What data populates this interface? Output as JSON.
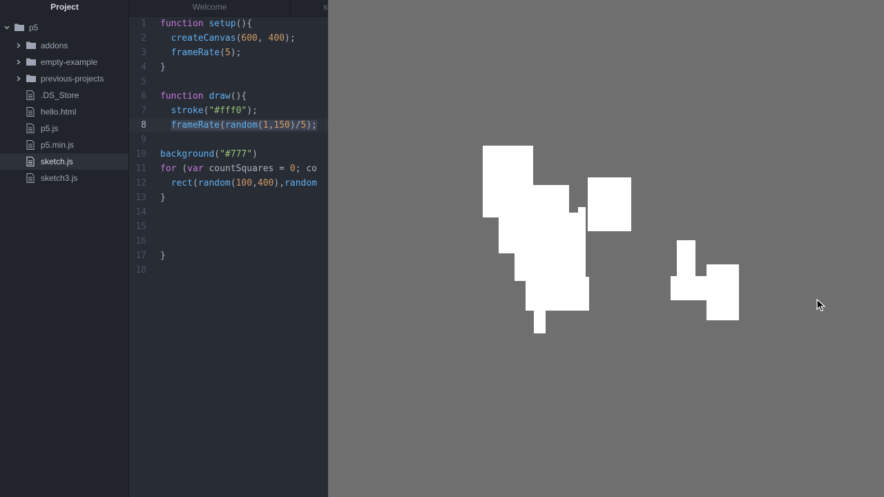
{
  "sidebar": {
    "title": "Project",
    "root": "p5",
    "items": [
      {
        "label": "addons",
        "type": "folder"
      },
      {
        "label": "empty-example",
        "type": "folder"
      },
      {
        "label": "previous-projects",
        "type": "folder"
      },
      {
        "label": ".DS_Store",
        "type": "file"
      },
      {
        "label": "hello.html",
        "type": "file"
      },
      {
        "label": "p5.js",
        "type": "file"
      },
      {
        "label": "p5.min.js",
        "type": "file"
      },
      {
        "label": "sketch.js",
        "type": "file",
        "selected": true
      },
      {
        "label": "sketch3.js",
        "type": "file"
      }
    ]
  },
  "tabs": {
    "welcome": "Welcome",
    "sketch": "sketch.js"
  },
  "editor": {
    "cursor_line": 8,
    "lines": [
      [
        [
          "kw",
          "function "
        ],
        [
          "fn",
          "setup"
        ],
        [
          "pl",
          "(){"
        ]
      ],
      [
        [
          "pl",
          "  "
        ],
        [
          "fn",
          "createCanvas"
        ],
        [
          "pl",
          "("
        ],
        [
          "num",
          "600"
        ],
        [
          "pl",
          ", "
        ],
        [
          "num",
          "400"
        ],
        [
          "pl",
          ");"
        ]
      ],
      [
        [
          "pl",
          "  "
        ],
        [
          "fn",
          "frameRate"
        ],
        [
          "pl",
          "("
        ],
        [
          "num",
          "5"
        ],
        [
          "pl",
          ");"
        ]
      ],
      [
        [
          "pl",
          "}"
        ]
      ],
      [],
      [
        [
          "kw",
          "function "
        ],
        [
          "fn",
          "draw"
        ],
        [
          "pl",
          "(){"
        ]
      ],
      [
        [
          "pl",
          "  "
        ],
        [
          "fn",
          "stroke"
        ],
        [
          "pl",
          "("
        ],
        [
          "str",
          "\"#fff0\""
        ],
        [
          "pl",
          ");"
        ]
      ],
      [
        [
          "pl",
          "  "
        ],
        [
          "fn",
          "frameRate"
        ],
        [
          "pl",
          "("
        ],
        [
          "fn",
          "random"
        ],
        [
          "pl",
          "("
        ],
        [
          "num",
          "1"
        ],
        [
          "pl",
          ","
        ],
        [
          "num",
          "150"
        ],
        [
          "pl",
          ")/"
        ],
        [
          "num",
          "5"
        ],
        [
          "pl",
          ");"
        ]
      ],
      [],
      [
        [
          "fn",
          "background"
        ],
        [
          "pl",
          "("
        ],
        [
          "str",
          "\"#777\""
        ],
        [
          "pl",
          ")"
        ]
      ],
      [
        [
          "kw",
          "for "
        ],
        [
          "pl",
          "("
        ],
        [
          "kw",
          "var "
        ],
        [
          "pl",
          "countSquares = "
        ],
        [
          "num",
          "0"
        ],
        [
          "pl",
          "; co"
        ]
      ],
      [
        [
          "pl",
          "  "
        ],
        [
          "fn",
          "rect"
        ],
        [
          "pl",
          "("
        ],
        [
          "fn",
          "random"
        ],
        [
          "pl",
          "("
        ],
        [
          "num",
          "100"
        ],
        [
          "pl",
          ","
        ],
        [
          "num",
          "400"
        ],
        [
          "pl",
          "),"
        ],
        [
          "fn",
          "random"
        ]
      ],
      [
        [
          "pl",
          "}"
        ]
      ],
      [],
      [],
      [],
      [
        [
          "pl",
          "}"
        ]
      ],
      []
    ]
  },
  "preview": {
    "background": "#6f6f6f",
    "fill": "#ffffff"
  },
  "colors": {
    "sidebar_bg": "#21252b",
    "editor_bg": "#282c34",
    "keyword": "#c678dd",
    "function": "#61afef",
    "number": "#d19a66",
    "string": "#98c379"
  }
}
